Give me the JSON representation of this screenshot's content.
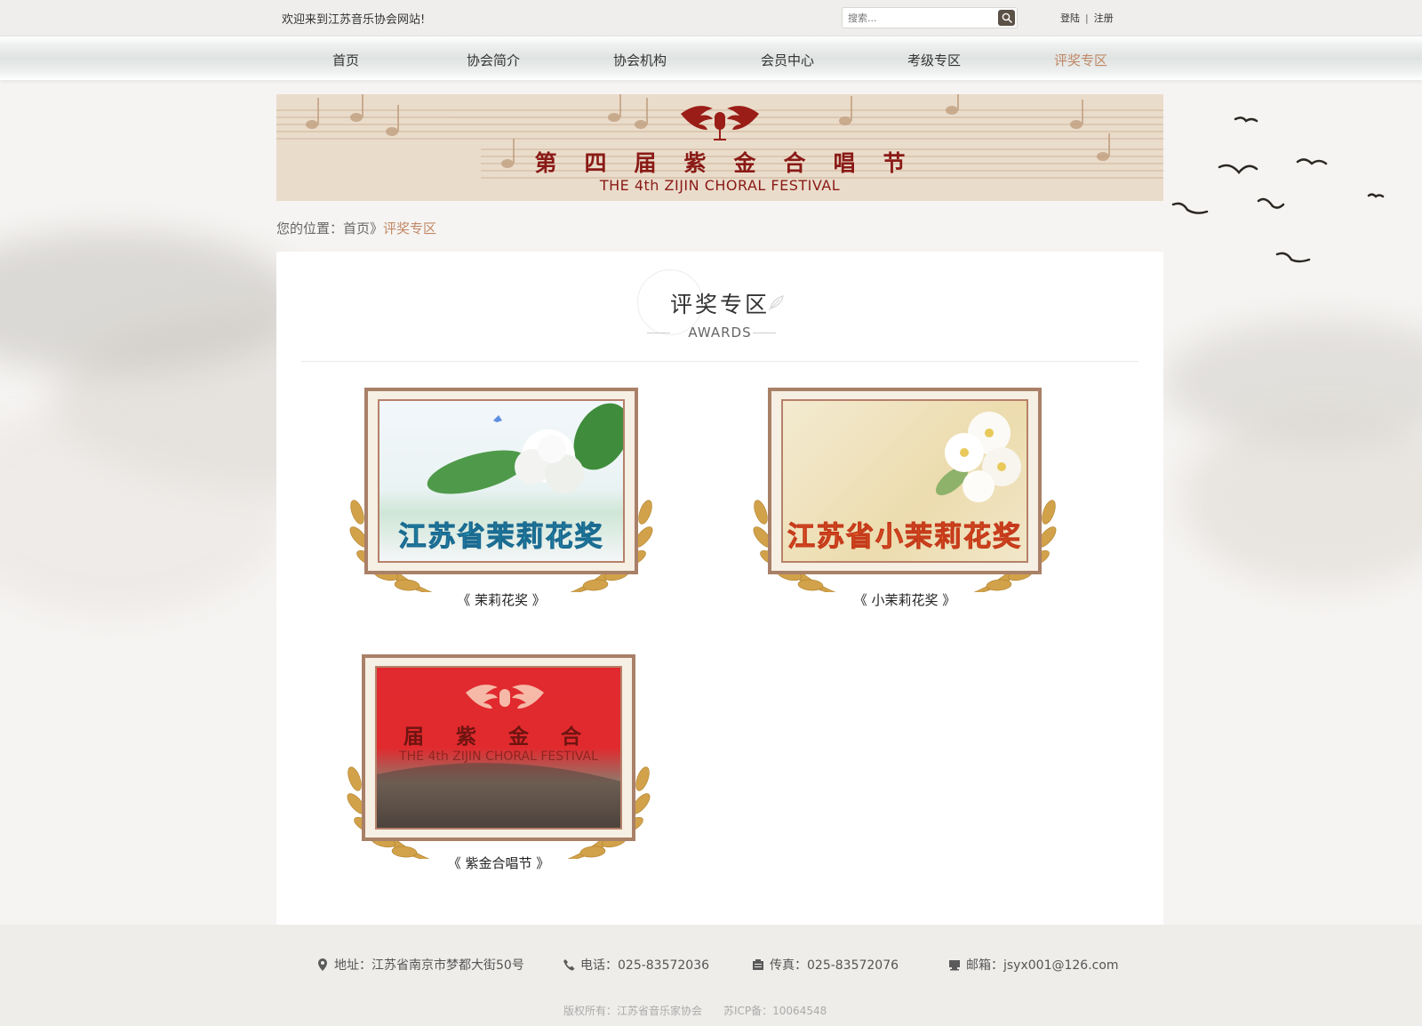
{
  "topbar": {
    "welcome": "欢迎来到江苏音乐协会网站!",
    "search_placeholder": "搜索...",
    "login": "登陆",
    "separator": "|",
    "register": "注册"
  },
  "nav": {
    "items": [
      "首页",
      "协会简介",
      "协会机构",
      "会员中心",
      "考级专区",
      "评奖专区"
    ],
    "active_index": 5
  },
  "banner": {
    "title": "第四届紫金合唱节",
    "subtitle": "THE 4th ZIJIN CHORAL FESTIVAL"
  },
  "breadcrumb": {
    "prefix": "您的位置：",
    "home": "首页",
    "sep": "》",
    "current": "评奖专区"
  },
  "section": {
    "title": "评奖专区",
    "subtitle": "AWARDS"
  },
  "awards": [
    {
      "image_text": "江苏省茉莉花奖",
      "caption": "《 茉莉花奖 》"
    },
    {
      "image_text": "江苏省小茉莉花奖",
      "caption": "《 小茉莉花奖 》"
    },
    {
      "image_text_main": "届 紫 金 合",
      "image_text_sub": "THE 4th ZIJIN CHORAL FESTIVAL",
      "caption": "《 紫金合唱节 》"
    }
  ],
  "footer": {
    "address": "地址：江苏省南京市梦都大街50号",
    "phone": "电话：025-83572036",
    "fax": "传真：025-83572076",
    "email": "邮箱：jsyx001@126.com",
    "copyright": "版权所有：江苏省音乐家协会",
    "icp": "苏ICP备：10064548"
  },
  "colors": {
    "accent": "#c08866",
    "banner_red": "#8a1a16",
    "frame_brown": "#a98068",
    "gold": "#d2a24a"
  },
  "icons": [
    "search-icon",
    "location-icon",
    "phone-icon",
    "fax-icon",
    "email-icon",
    "laurel-wreath-icon",
    "winged-microphone-icon"
  ]
}
